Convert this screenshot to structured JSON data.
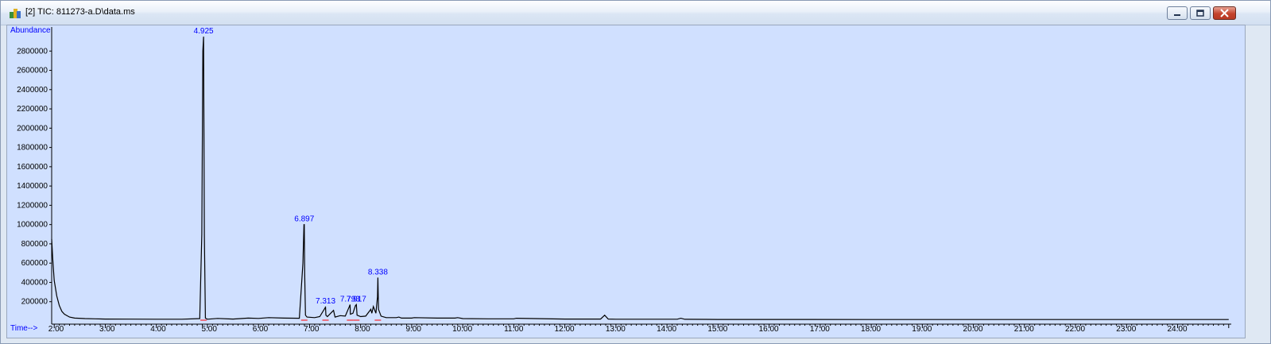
{
  "window": {
    "title": "[2] TIC: 811273-a.D\\data.ms",
    "icon": "chromatogram-app-icon",
    "buttons": [
      "minimize-icon",
      "restore-icon",
      "close-icon"
    ]
  },
  "colors": {
    "plot_background": "#d0e0ff",
    "trace": "#000000",
    "label_text": "#0000ff",
    "baseline_marks": "#ff0000"
  },
  "chart_data": {
    "type": "line",
    "ylabel": "Abundance",
    "xlabel": "Time-->",
    "xlim": [
      1.95,
      25.05
    ],
    "ylim": [
      0,
      3000000
    ],
    "x_ticks": [
      "2.00",
      "3.00",
      "4.00",
      "5.00",
      "6.00",
      "7.00",
      "8.00",
      "9.00",
      "10.00",
      "11.00",
      "12.00",
      "13.00",
      "14.00",
      "15.00",
      "16.00",
      "17.00",
      "18.00",
      "19.00",
      "20.00",
      "21.00",
      "22.00",
      "23.00",
      "24.00"
    ],
    "y_ticks": [
      "200000",
      "400000",
      "600000",
      "800000",
      "1000000",
      "1200000",
      "1400000",
      "1600000",
      "1800000",
      "2000000",
      "2200000",
      "2400000",
      "2600000",
      "2800000"
    ],
    "series": [
      {
        "x": [
          1.95,
          1.97,
          2.0,
          2.05,
          2.1,
          2.15,
          2.2,
          2.3,
          2.4,
          2.6,
          2.8,
          3.0,
          3.5,
          4.0,
          4.5,
          4.85,
          4.89,
          4.91,
          4.925,
          4.94,
          4.96,
          5.0,
          5.2,
          5.5,
          5.8,
          6.0,
          6.2,
          6.5,
          6.8,
          6.87,
          6.89,
          6.897,
          6.905,
          6.92,
          6.95,
          7.1,
          7.2,
          7.31,
          7.313,
          7.32,
          7.35,
          7.45,
          7.47,
          7.5,
          7.6,
          7.7,
          7.78,
          7.793,
          7.8,
          7.85,
          7.9,
          7.917,
          7.93,
          8.0,
          8.1,
          8.2,
          8.22,
          8.25,
          8.3,
          8.33,
          8.338,
          8.35,
          8.4,
          8.5,
          8.7,
          8.75,
          8.8,
          9.0,
          9.05,
          9.5,
          9.85,
          9.9,
          10.0,
          10.5,
          11.0,
          11.05,
          12.0,
          12.7,
          12.78,
          12.85,
          13.0,
          14.2,
          14.27,
          14.35,
          15.0,
          18.0,
          21.0,
          24.0,
          25.0
        ],
        "y": [
          850000,
          650000,
          420000,
          260000,
          160000,
          100000,
          70000,
          40000,
          30000,
          25000,
          22000,
          20000,
          19000,
          18000,
          18000,
          25000,
          900000,
          2800000,
          2950000,
          900000,
          30000,
          18000,
          26000,
          20000,
          30000,
          26000,
          35000,
          30000,
          28000,
          600000,
          1000000,
          1000000,
          500000,
          60000,
          40000,
          35000,
          45000,
          140000,
          150000,
          60000,
          45000,
          100000,
          110000,
          40000,
          55000,
          50000,
          150000,
          170000,
          70000,
          80000,
          160000,
          170000,
          60000,
          45000,
          50000,
          120000,
          80000,
          150000,
          80000,
          250000,
          450000,
          120000,
          50000,
          35000,
          35000,
          40000,
          30000,
          30000,
          35000,
          30000,
          30000,
          35000,
          25000,
          22000,
          22000,
          28000,
          20000,
          20000,
          60000,
          20000,
          18000,
          18000,
          28000,
          17000,
          16000,
          15000,
          15000,
          15000,
          15000
        ]
      }
    ],
    "peak_labels": [
      {
        "x": 4.925,
        "y": 2950000,
        "text": "4.925"
      },
      {
        "x": 6.897,
        "y": 1000000,
        "text": "6.897"
      },
      {
        "x": 7.313,
        "y": 150000,
        "text": "7.313"
      },
      {
        "x": 7.793,
        "y": 170000,
        "text": "7.793"
      },
      {
        "x": 7.917,
        "y": 170000,
        "text": "7.917"
      },
      {
        "x": 8.338,
        "y": 450000,
        "text": "8.338"
      }
    ]
  }
}
